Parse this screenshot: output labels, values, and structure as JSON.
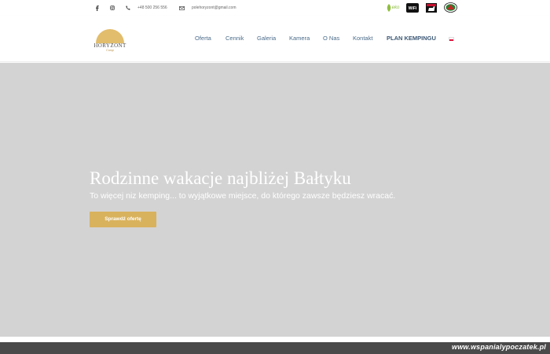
{
  "topbar": {
    "phone": "+48 500 256 556",
    "email": "polehoryzont@gmail.com",
    "icons": [
      "facebook-icon",
      "instagram-icon",
      "phone-icon",
      "envelope-icon"
    ],
    "badges": {
      "eko": "eko",
      "wifi": "WiFi",
      "dog": "dog-friendly-icon",
      "camping": "camping-badge-icon"
    }
  },
  "logo": {
    "name": "HORYZONT",
    "sub": "Camp"
  },
  "nav": {
    "items": [
      "Oferta",
      "Cennik",
      "Galeria",
      "Kamera",
      "O Nas",
      "Kontakt",
      "PLAN KEMPINGU"
    ],
    "language_flag": "pl-flag-icon"
  },
  "hero": {
    "title": "Rodzinne wakacje najbliżej Bałtyku",
    "subtitle": "To więcej niz kemping... to wyjątkowe miejsce, do którego zawsze będziesz wracać.",
    "cta": "Sprawdź ofertę"
  },
  "footer": {
    "watermark": "www.wspanialypoczatek.pl"
  },
  "colors": {
    "accent": "#d9b25d",
    "nav_link": "#4a6b8a",
    "hero_bg": "#d3d3d3",
    "footer_bg": "#4a4a4a"
  }
}
